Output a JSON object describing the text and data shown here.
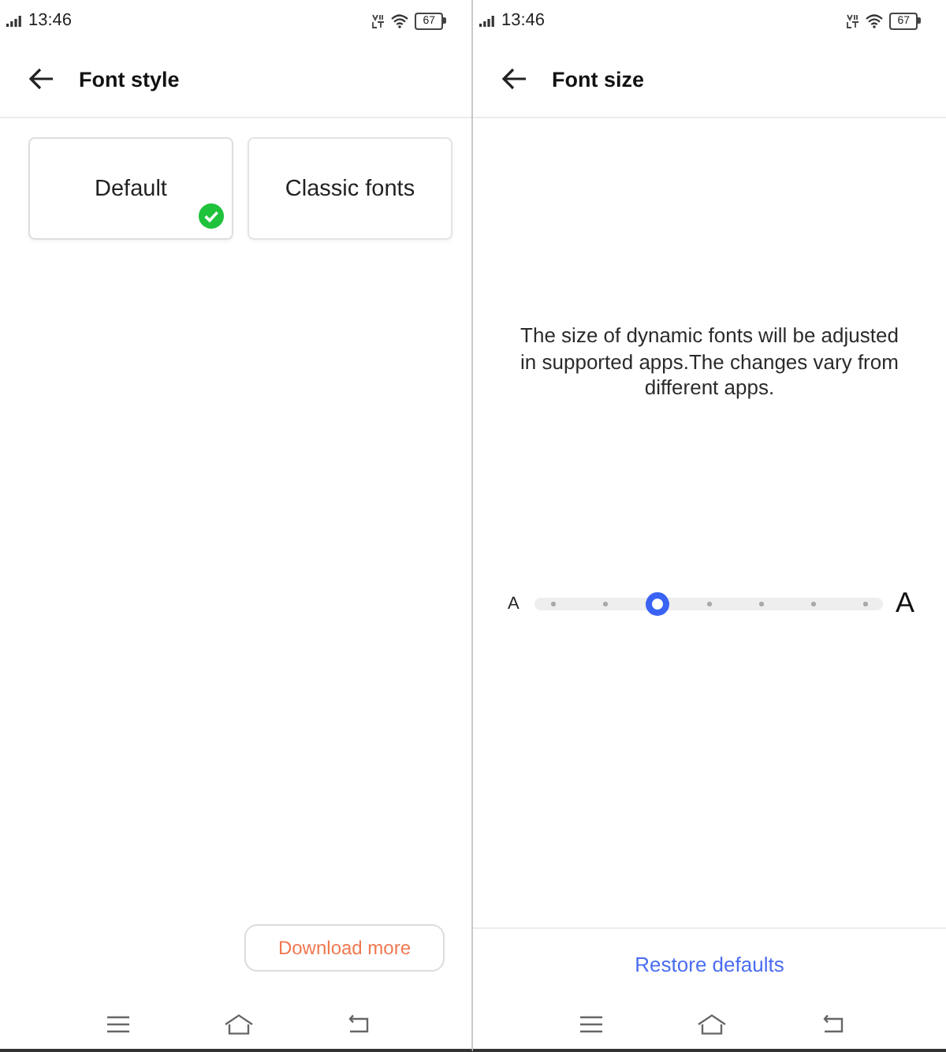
{
  "screens": [
    {
      "kind": "font_style",
      "status_bar": {
        "time": "13:46",
        "battery": "67"
      },
      "header": {
        "title": "Font style"
      },
      "options": [
        {
          "label": "Default",
          "selected": true
        },
        {
          "label": "Classic fonts",
          "selected": false
        }
      ],
      "action_button": {
        "label": "Download more"
      }
    },
    {
      "kind": "font_size",
      "status_bar": {
        "time": "13:46",
        "battery": "67"
      },
      "header": {
        "title": "Font size"
      },
      "description": "The size of dynamic fonts will be adjusted in supported apps.The changes vary from different apps.",
      "slider": {
        "min_label": "A",
        "max_label": "A",
        "level": 0.33
      },
      "footer_button": {
        "label": "Restore defaults"
      }
    }
  ]
}
